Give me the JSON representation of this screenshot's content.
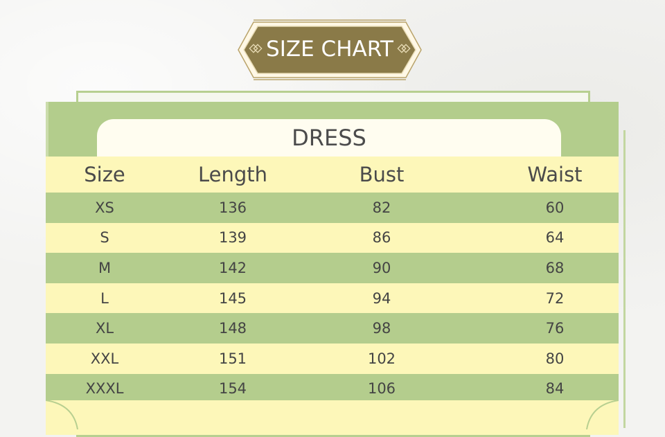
{
  "badge": {
    "title": "SIZE CHART"
  },
  "table": {
    "title": "DRESS",
    "headers": [
      "Size",
      "Length",
      "Bust",
      "Waist"
    ],
    "rows": [
      [
        "XS",
        "136",
        "82",
        "60"
      ],
      [
        "S",
        "139",
        "86",
        "64"
      ],
      [
        "M",
        "142",
        "90",
        "68"
      ],
      [
        "L",
        "145",
        "94",
        "72"
      ],
      [
        "XL",
        "148",
        "98",
        "76"
      ],
      [
        "XXL",
        "151",
        "102",
        "80"
      ],
      [
        "XXXL",
        "154",
        "106",
        "84"
      ]
    ]
  },
  "colors": {
    "badge_fill": "#8a7a48",
    "badge_border": "#b9a36a",
    "green": "#b4cd8d",
    "yellow": "#fdf7b9",
    "text": "#444444"
  }
}
